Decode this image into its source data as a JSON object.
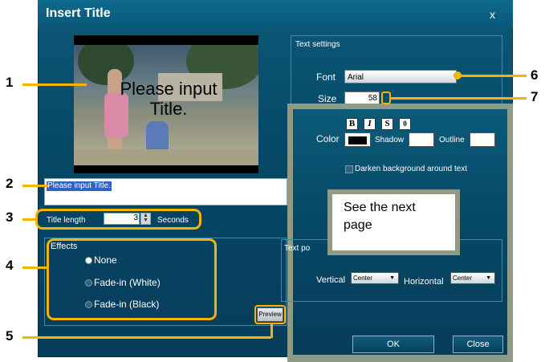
{
  "dialog": {
    "title": "Insert Title",
    "close_label": "x"
  },
  "preview": {
    "overlay_text_line1": "Please input",
    "overlay_text_line2": "Title."
  },
  "title_input": {
    "value": "Please input Title."
  },
  "title_length": {
    "label": "Title length",
    "value": "3",
    "unit": "Seconds"
  },
  "effects": {
    "title": "Effects",
    "options": [
      {
        "label": "None",
        "selected": true
      },
      {
        "label": "Fade-in (White)",
        "selected": false
      },
      {
        "label": "Fade-in (Black)",
        "selected": false
      }
    ],
    "preview_button": "Preview"
  },
  "text_settings": {
    "title": "Text settings",
    "font_label": "Font",
    "font_value": "Arial",
    "size_label": "Size",
    "size_value": "58",
    "format_buttons": [
      "B",
      "I",
      "S",
      "0"
    ],
    "color_label": "Color",
    "shadow_label": "Shadow",
    "outline_label": "Outline",
    "darken_label": "Darken background around text",
    "text_position_title": "Text po",
    "vertical_label": "Vertical",
    "vertical_value": "Center",
    "horizontal_label": "Horizontal",
    "horizontal_value": "Center"
  },
  "buttons": {
    "ok": "OK",
    "close": "Close"
  },
  "callout": {
    "line1": "See the next",
    "line2": "page"
  },
  "annotations": [
    "1",
    "2",
    "3",
    "4",
    "5",
    "6",
    "7"
  ],
  "colors": {
    "dialog_bg": "#064867",
    "highlight": "#f4b400",
    "overlay_frame": "#8e9b86"
  }
}
